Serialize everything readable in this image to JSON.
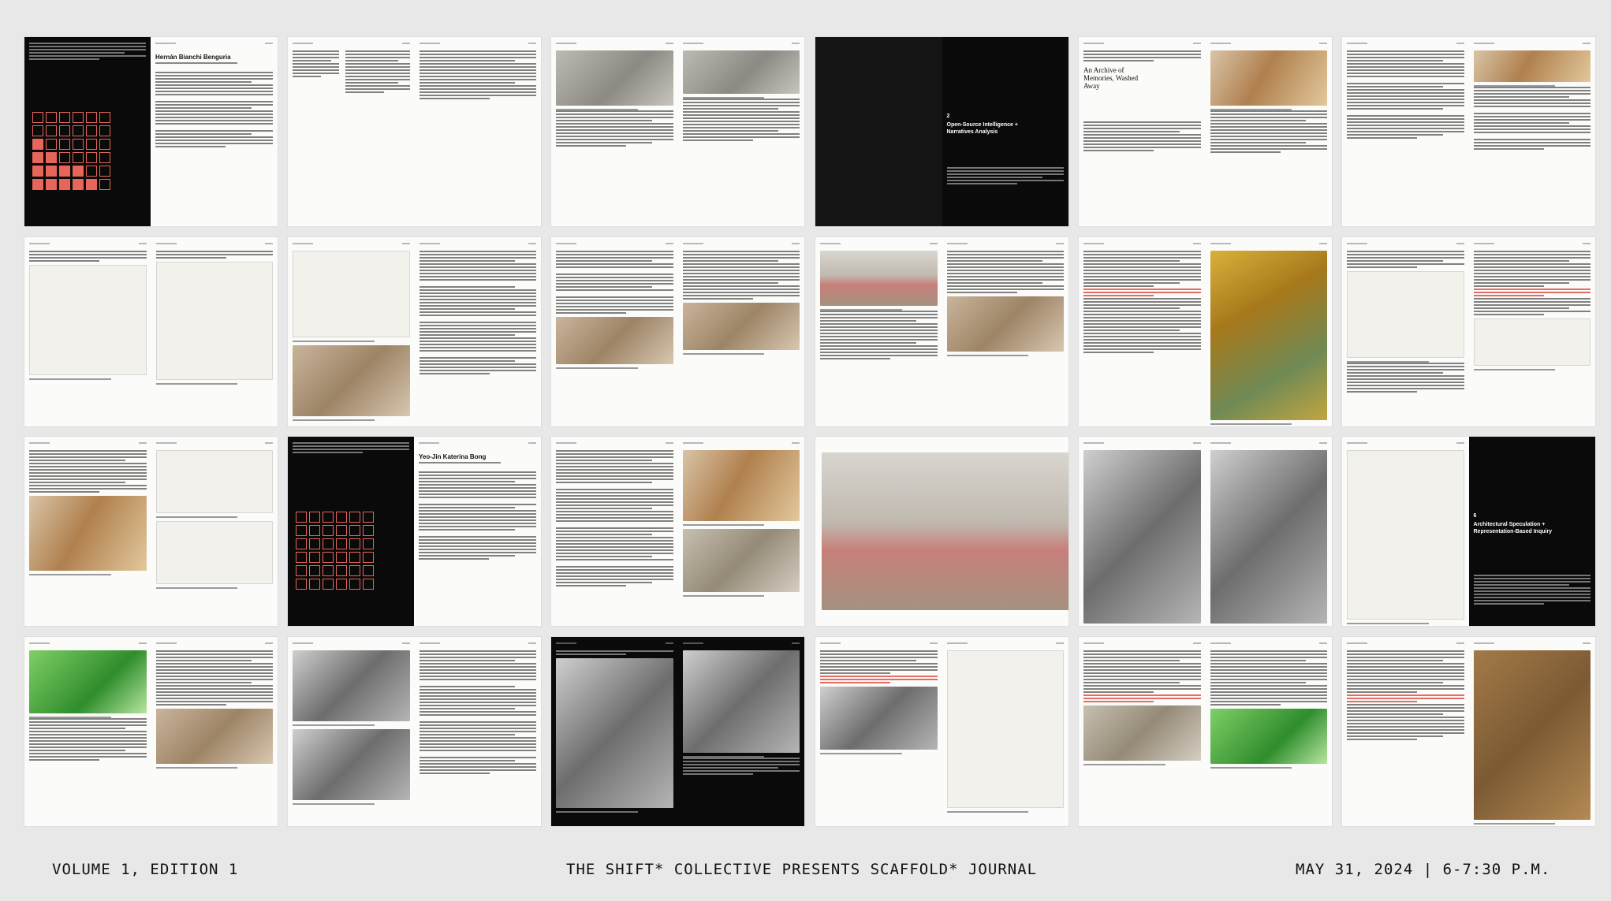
{
  "journal": {
    "covers": [
      {
        "title": "Hernán Bianchi Benguria"
      },
      {
        "title": "Yeo-Jin Katerina Bong"
      }
    ],
    "chapters": [
      {
        "number": "2",
        "title_line1": "Open-Source Intelligence +",
        "title_line2": "Narratives Analysis"
      },
      {
        "number": "6",
        "title_line1": "Architectural Speculation +",
        "title_line2": "Representation-Based Inquiry"
      }
    ],
    "archive_title": {
      "line1": "An Archive of",
      "line2": "Memories, Washed",
      "line3": "Away"
    }
  },
  "footer": {
    "left": "VOLUME 1, EDITION 1",
    "center": "THE SHIFT* COLLECTIVE PRESENTS SCAFFOLD* JOURNAL",
    "right": "MAY 31, 2024 | 6-7:30 P.M."
  },
  "colors": {
    "background": "#e8e8e8",
    "accent_red": "#e86559",
    "page": "#fbfbf9",
    "dark_page": "#0a0a0a"
  }
}
